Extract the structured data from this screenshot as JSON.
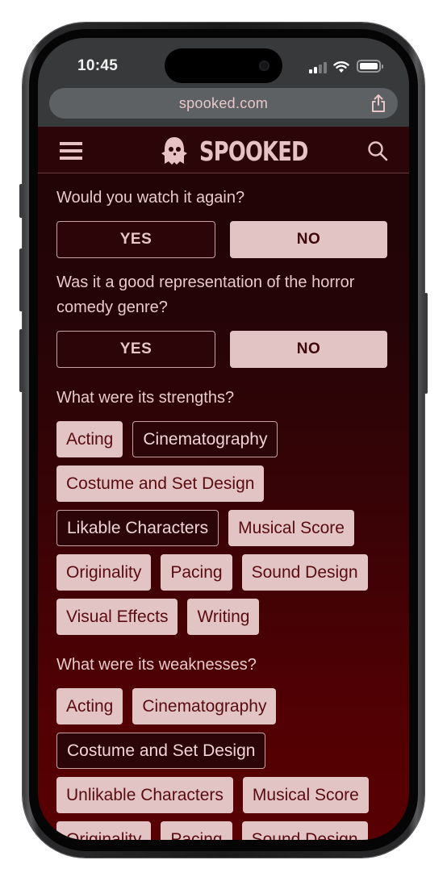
{
  "status_bar": {
    "time": "10:45",
    "signal_icon": "cellular-signal-icon",
    "wifi_icon": "wifi-icon",
    "battery_icon": "battery-icon"
  },
  "browser": {
    "url": "spooked.com",
    "share_icon": "share-icon"
  },
  "header": {
    "menu_icon": "hamburger-menu-icon",
    "logo_icon": "ghost-icon",
    "logo_text": "SPOOKED",
    "search_icon": "search-icon"
  },
  "questions": {
    "watch_again": {
      "label": "Would you watch it again?",
      "options": [
        {
          "label": "YES",
          "selected": false
        },
        {
          "label": "NO",
          "selected": true
        }
      ]
    },
    "genre_representation": {
      "label": "Was it a good representation of the horror comedy genre?",
      "options": [
        {
          "label": "YES",
          "selected": false
        },
        {
          "label": "NO",
          "selected": true
        }
      ]
    },
    "strengths": {
      "label": "What were its strengths?",
      "chips": [
        {
          "label": "Acting",
          "selected": true
        },
        {
          "label": "Cinematography",
          "selected": false
        },
        {
          "label": "Costume and Set Design",
          "selected": true
        },
        {
          "label": "Likable Characters",
          "selected": false
        },
        {
          "label": "Musical Score",
          "selected": true
        },
        {
          "label": "Originality",
          "selected": true
        },
        {
          "label": "Pacing",
          "selected": true
        },
        {
          "label": "Sound Design",
          "selected": true
        },
        {
          "label": "Visual Effects",
          "selected": true
        },
        {
          "label": "Writing",
          "selected": true
        }
      ]
    },
    "weaknesses": {
      "label": "What were its weaknesses?",
      "chips": [
        {
          "label": "Acting",
          "selected": true
        },
        {
          "label": "Cinematography",
          "selected": true
        },
        {
          "label": "Costume and Set Design",
          "selected": false
        },
        {
          "label": "Unlikable Characters",
          "selected": true
        },
        {
          "label": "Musical Score",
          "selected": true
        },
        {
          "label": "Originality",
          "selected": true
        },
        {
          "label": "Pacing",
          "selected": true
        },
        {
          "label": "Sound Design",
          "selected": true
        }
      ]
    }
  },
  "colors": {
    "chip_filled_bg": "#e2c4c5",
    "chip_filled_text": "#5a0b10",
    "chip_outline_bg": "#2c0508",
    "chip_outline_border": "#c9a2a4",
    "header_bg": "#2c0508",
    "page_gradient_top": "#1e0305",
    "page_gradient_bottom": "#580003"
  }
}
